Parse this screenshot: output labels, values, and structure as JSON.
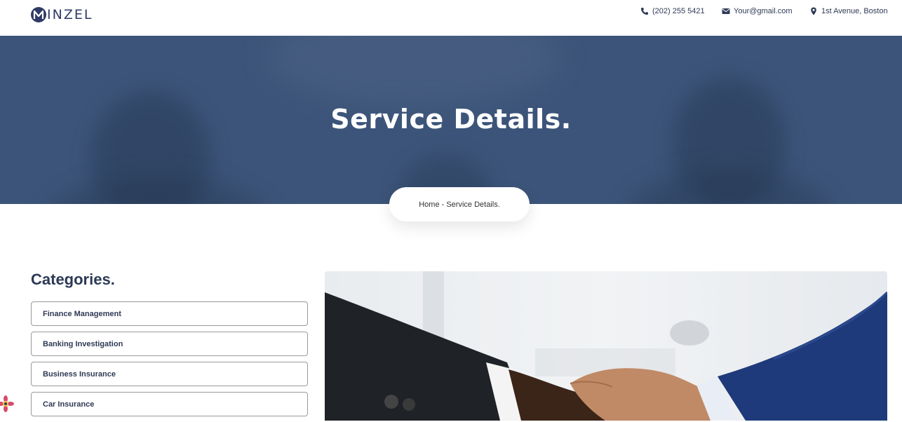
{
  "header": {
    "logo_text": "INZEL",
    "logo_letter": "M",
    "phone": "(202) 255 5421",
    "email": "Your@gmail.com",
    "address": "1st Avenue, Boston"
  },
  "hero": {
    "title": "Service Details.",
    "breadcrumb": "Home - Service Details."
  },
  "sidebar": {
    "title": "Categories.",
    "items": [
      {
        "label": "Finance Management"
      },
      {
        "label": "Banking Investigation"
      },
      {
        "label": "Business Insurance"
      },
      {
        "label": "Car Insurance"
      }
    ]
  },
  "colors": {
    "brand": "#2f3a66",
    "hero_overlay": "#3c5479",
    "text_dark": "#2b3a55"
  },
  "icons": [
    "phone-icon",
    "envelope-icon",
    "map-pin-icon",
    "floating-widget-icon"
  ]
}
